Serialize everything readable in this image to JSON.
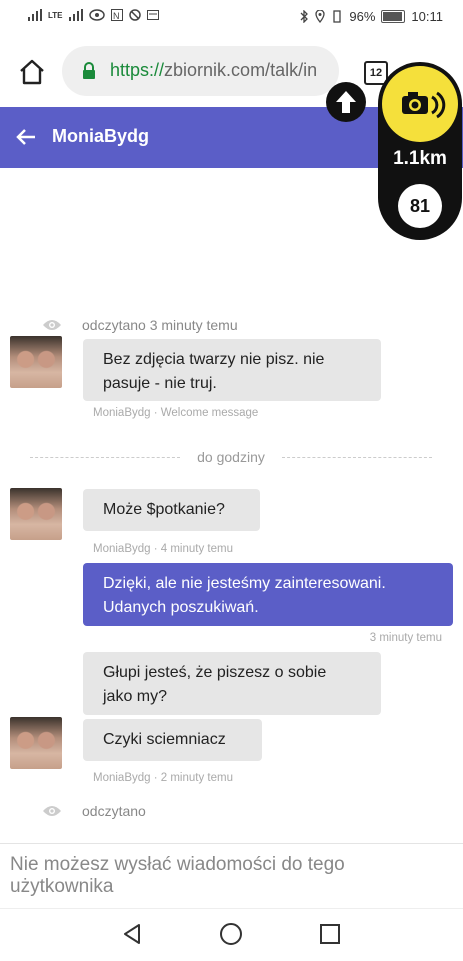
{
  "status_bar": {
    "network_label": "LTE",
    "battery": "96%",
    "time": "10:11"
  },
  "browser": {
    "url_scheme": "https://",
    "url_rest": "zbiornik.com/talk/in",
    "tabs_count": "12"
  },
  "appbar": {
    "title": "MoniaBydg",
    "accent": "#5b5ec7"
  },
  "radar_overlay": {
    "distance": "1.1km",
    "speed_limit": "81",
    "icon": "camera-icon"
  },
  "messages": {
    "read_top": "odczytano 3 minuty temu",
    "msg1": {
      "lines": [
        "Bez zdjęcia twarzy nie pisz. nie",
        "pasuje - nie truj."
      ],
      "meta": "MoniaBydg · Welcome message"
    },
    "divider": "do godziny",
    "msg2": {
      "text": "Może $potkanie?",
      "meta": "MoniaBydg · 4 minuty temu"
    },
    "msg3": {
      "lines": [
        "Dzięki, ale nie jesteśmy zainteresowani.",
        "Udanych poszukiwań."
      ],
      "meta": "3 minuty temu"
    },
    "msg4": {
      "lines": [
        "Głupi jesteś, że piszesz o sobie",
        "jako my?"
      ]
    },
    "msg5": {
      "text": "Czyki sciemniacz",
      "meta": "MoniaBydg · 2 minuty temu"
    },
    "read_bottom": "odczytano"
  },
  "composer": {
    "notice": "Nie możesz wysłać wiadomości do tego użytkownika"
  }
}
